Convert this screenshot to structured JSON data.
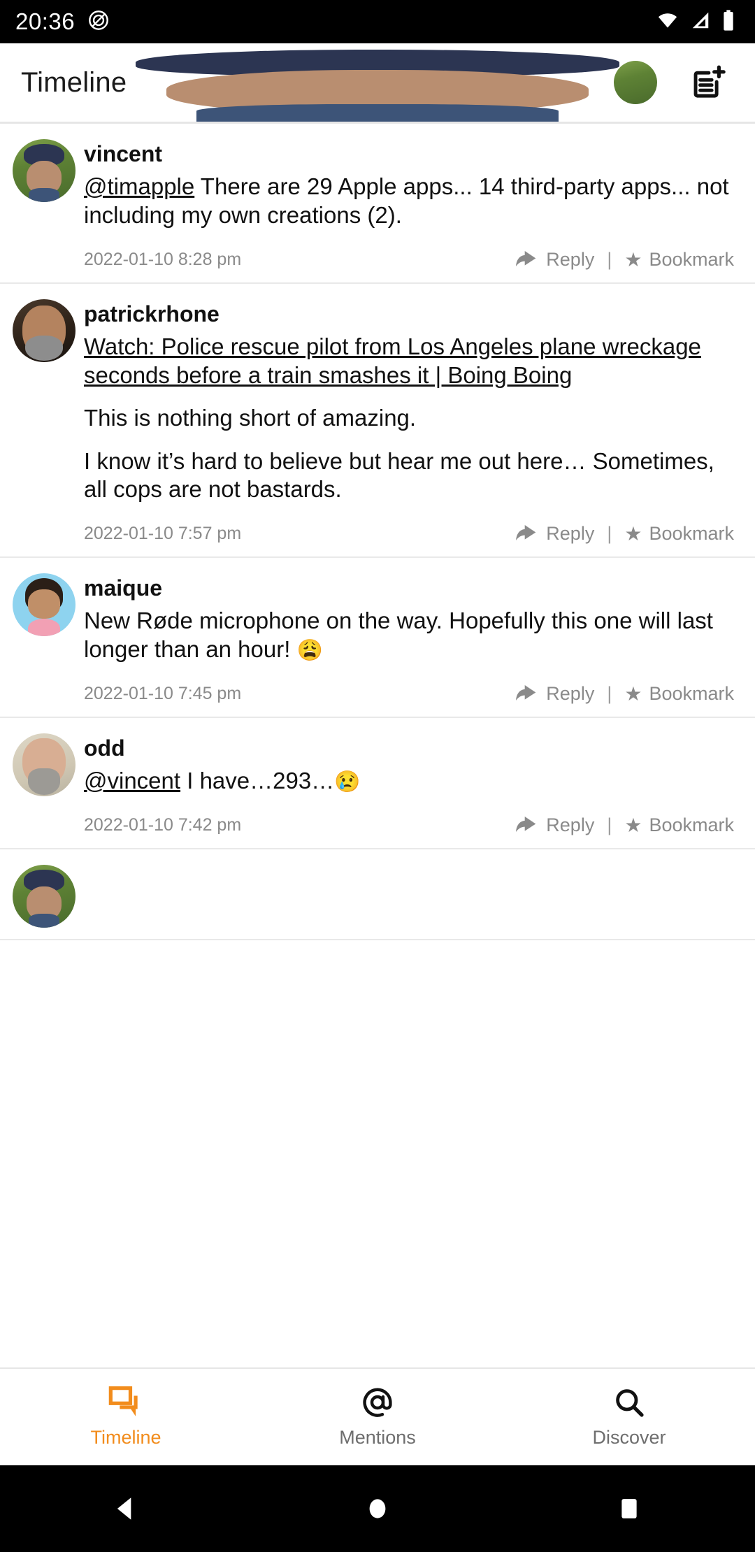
{
  "status_bar": {
    "time": "20:36",
    "icons": [
      "do-not-disturb-icon",
      "wifi-icon",
      "cellular-signal-icon",
      "battery-icon"
    ]
  },
  "app_bar": {
    "title": "Timeline",
    "avatar_name": "user-avatar",
    "compose_name": "compose-post-icon"
  },
  "actions": {
    "reply_label": "Reply",
    "bookmark_label": "Bookmark",
    "separator": "|"
  },
  "posts": [
    {
      "author": "vincent",
      "mention": "@timapple",
      "text": " There are 29 Apple apps... 14 third-party apps... not including my own creations (2).",
      "timestamp": "2022-01-10 8:28 pm",
      "avatar_class": "av-vincent"
    },
    {
      "author": "patrickrhone",
      "link": "Watch: Police rescue pilot from Los Angeles plane wreckage seconds before a train smashes it | Boing Boing",
      "paragraph1": "This is nothing short of amazing.",
      "paragraph2": "I know it’s hard to believe but hear me out here… Sometimes, all cops are not bastards.",
      "timestamp": "2022-01-10 7:57 pm",
      "avatar_class": "av-patrick"
    },
    {
      "author": "maique",
      "text": "New Røde microphone on the way. Hopefully this one will last longer than an hour! ",
      "emoji": "😩",
      "timestamp": "2022-01-10 7:45 pm",
      "avatar_class": "av-maique"
    },
    {
      "author": "odd",
      "mention": "@vincent",
      "text": " I have…293…",
      "emoji": "😢",
      "timestamp": "2022-01-10 7:42 pm",
      "avatar_class": "av-odd"
    }
  ],
  "bottom_nav": {
    "items": [
      {
        "label": "Timeline",
        "icon": "chat-bubbles-icon",
        "active": true
      },
      {
        "label": "Mentions",
        "icon": "at-sign-icon",
        "active": false
      },
      {
        "label": "Discover",
        "icon": "search-icon",
        "active": false
      }
    ]
  },
  "android_nav": {
    "back": "back-triangle-icon",
    "home": "home-circle-icon",
    "recents": "recents-square-icon"
  },
  "colors": {
    "accent": "#f28c1c",
    "text": "#111111",
    "muted": "#8a8a8a",
    "divider": "#e9e9e9",
    "background": "#ffffff",
    "system_bar": "#000000"
  }
}
